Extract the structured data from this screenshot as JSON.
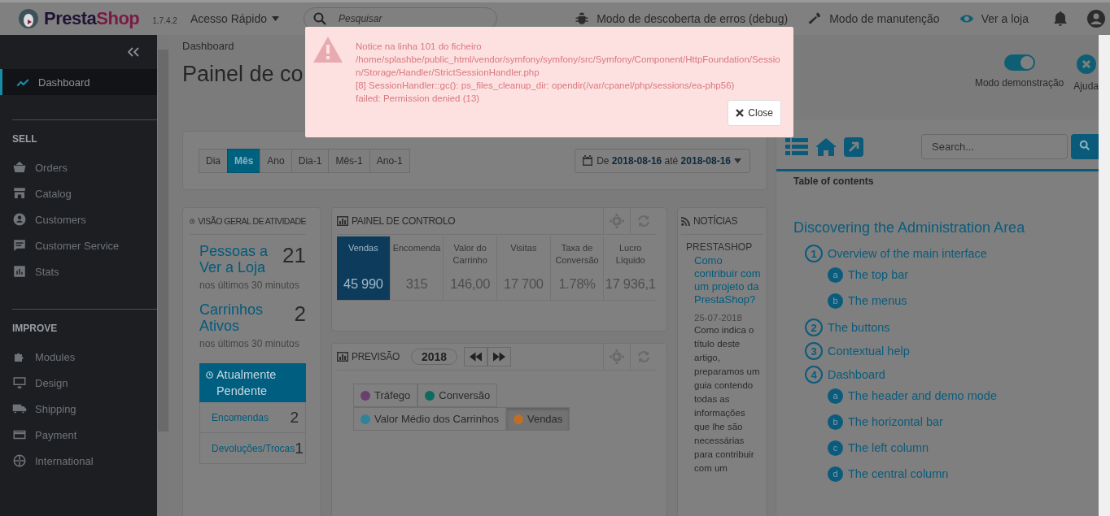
{
  "header": {
    "logo_a": "Presta",
    "logo_b": "Shop",
    "version": "1.7.4.2",
    "quick_access": "Acesso Rápido",
    "search": {
      "placeholder": "Pesquisar"
    },
    "links": [
      {
        "label": "Modo de descoberta de erros (debug)"
      },
      {
        "label": "Modo de manutenção"
      },
      {
        "label": "Ver a loja"
      }
    ]
  },
  "sidebar": {
    "items": [
      {
        "label": "Dashboard",
        "selected": true
      }
    ],
    "sections": [
      {
        "title": "SELL",
        "items": [
          {
            "label": "Orders",
            "selected": false
          },
          {
            "label": "Catalog",
            "selected": false
          },
          {
            "label": "Customers",
            "selected": false
          },
          {
            "label": "Customer Service",
            "selected": false
          },
          {
            "label": "Stats",
            "selected": false
          }
        ]
      },
      {
        "title": "IMPROVE",
        "items": [
          {
            "label": "Modules",
            "selected": false
          },
          {
            "label": "Design",
            "selected": false
          },
          {
            "label": "Shipping",
            "selected": false
          },
          {
            "label": "Payment",
            "selected": false
          },
          {
            "label": "International",
            "selected": false
          }
        ]
      }
    ]
  },
  "page_header": {
    "breadcrumb": "Dashboard",
    "title": "Painel de co",
    "toolbar": [
      {
        "kind": "toggle",
        "label": "Modo demonstração",
        "on": true
      },
      {
        "kind": "close",
        "label": "Ajuda"
      }
    ]
  },
  "notice": {
    "lines": [
      "Notice na linha 101 do ficheiro",
      "/home/splashbe/public_html/vendor/symfony/symfony/src/Symfony/Component/HttpFoundation/Session/Storage/Handler/StrictSessionHandler.php",
      "[8] SessionHandler::gc(): ps_files_cleanup_dir: opendir(/var/cpanel/php/sessions/ea-php56)",
      "failed: Permission denied (13)"
    ],
    "close": "Close"
  },
  "periods": [
    {
      "label": "Dia",
      "selected": false
    },
    {
      "label": "Mês",
      "selected": true
    },
    {
      "label": "Ano",
      "selected": false
    },
    {
      "label": "Dia-1",
      "selected": false
    },
    {
      "label": "Mês-1",
      "selected": false
    },
    {
      "label": "Ano-1",
      "selected": false
    }
  ],
  "date_range": {
    "prefix": "De",
    "from": "2018-08-16",
    "sep": "até",
    "to": "2018-08-16"
  },
  "activity": {
    "title": "VISÃO GERAL DE ATIVIDADE",
    "stats": [
      {
        "label": "Pessoas a Ver a Loja",
        "value": "21",
        "sub": "nos últimos 30 minutos"
      },
      {
        "label": "Carrinhos Ativos",
        "value": "2",
        "sub": "nos últimos 30 minutos"
      }
    ],
    "pending": {
      "title": "Atualmente Pendente",
      "rows": [
        {
          "label": "Encomendas",
          "value": "2"
        },
        {
          "label": "Devoluções/Trocas",
          "value": "1"
        }
      ]
    }
  },
  "dashboard": {
    "title": "PAINEL DE CONTROLO",
    "kpis": [
      {
        "label": "Vendas",
        "value": "45 990",
        "selected": true
      },
      {
        "label": "Encomenda",
        "value": "315",
        "selected": false
      },
      {
        "label": "Valor do Carrinho",
        "value": "146,00",
        "selected": false
      },
      {
        "label": "Visitas",
        "value": "17 700",
        "selected": false
      },
      {
        "label": "Taxa de Conversão",
        "value": "1.78%",
        "selected": false
      },
      {
        "label": "Lucro Líquido",
        "value": "17 936,1",
        "selected": false
      }
    ]
  },
  "forecast": {
    "title": "PREVISÃO",
    "year": "2018",
    "legend": [
      {
        "label": "Tráfego",
        "color": "#6a3f6e",
        "selected": false
      },
      {
        "label": "Conversão",
        "color": "#0b6b5c",
        "selected": false
      },
      {
        "label": "Valor Médio dos Carrinhos",
        "color": "#2f8399",
        "selected": false
      },
      {
        "label": "Vendas",
        "color": "#bf6d28",
        "selected": true
      }
    ]
  },
  "news": {
    "title": "NOTÍCIAS",
    "source": "PRESTASHOP",
    "article_title": "Como contribuir com um projeto da PrestaShop?",
    "date": "25-07-2018",
    "text": "Como indica o título deste artigo, preparamos um guia contendo todas as informações que lhe são necessárias para contribuir com um"
  },
  "help": {
    "search": {
      "placeholder": "Search..."
    },
    "toc_title": "Table of contents",
    "heading": "Discovering the Administration Area",
    "toc": [
      {
        "num": "1",
        "label": "Overview of the main interface",
        "children": [
          {
            "num": "a",
            "label": "The top bar"
          },
          {
            "num": "b",
            "label": "The menus"
          }
        ]
      },
      {
        "num": "2",
        "label": "The buttons"
      },
      {
        "num": "3",
        "label": "Contextual help"
      },
      {
        "num": "4",
        "label": "Dashboard",
        "children": [
          {
            "num": "a",
            "label": "The header and demo mode"
          },
          {
            "num": "b",
            "label": "The horizontal bar"
          },
          {
            "num": "c",
            "label": "The left column"
          },
          {
            "num": "d",
            "label": "The central column"
          }
        ]
      }
    ]
  }
}
